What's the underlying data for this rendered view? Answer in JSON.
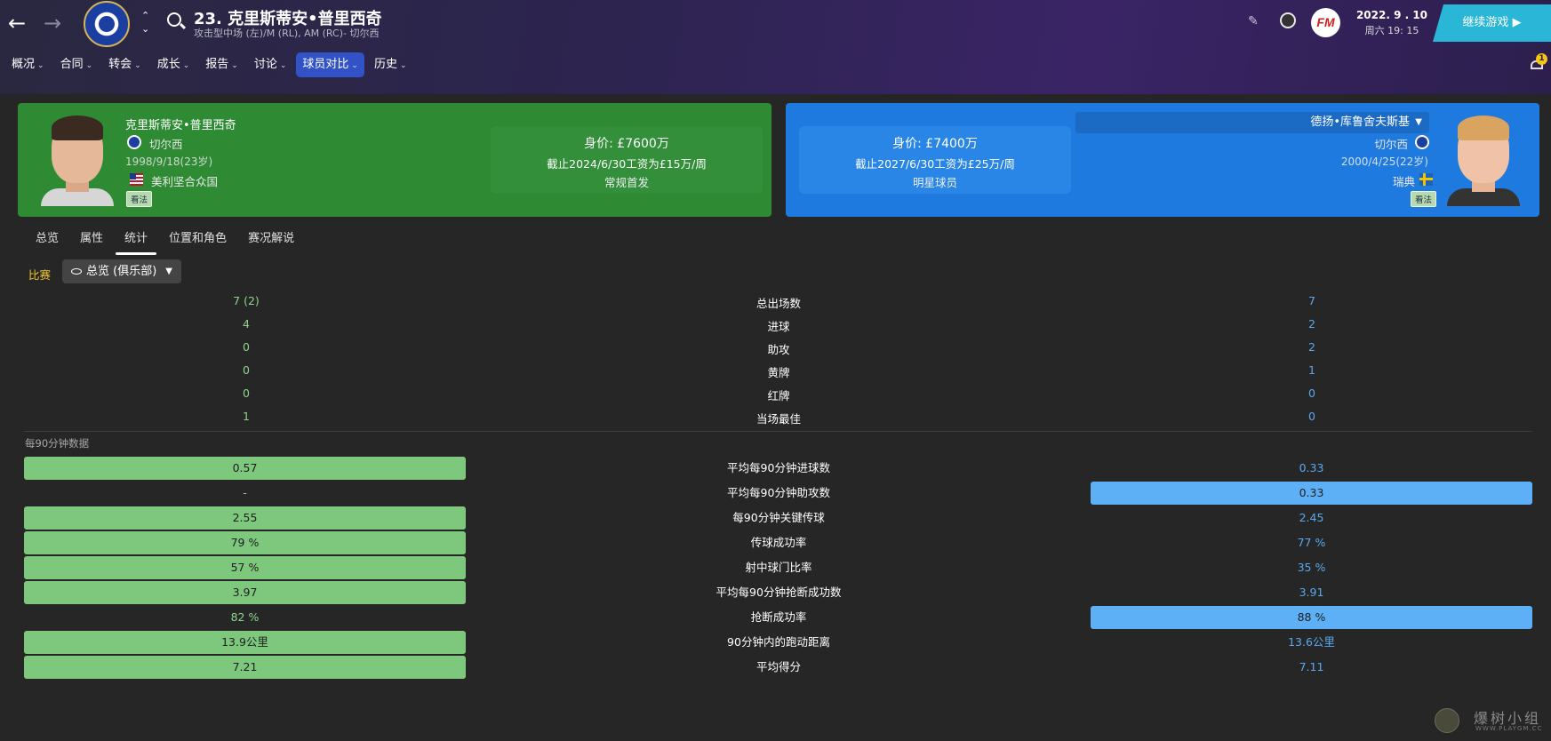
{
  "header": {
    "player_title": "23. 克里斯蒂安•普里西奇",
    "player_subtitle": "攻击型中场 (左)/M (RL), AM (RC)- 切尔西",
    "date_main": "2022. 9 . 10",
    "date_sub": "周六 19: 15",
    "continue_label": "继续游戏",
    "notification_count": "1",
    "fm_logo": "FM"
  },
  "menu": [
    {
      "label": "概况"
    },
    {
      "label": "合同"
    },
    {
      "label": "转会"
    },
    {
      "label": "成长"
    },
    {
      "label": "报告"
    },
    {
      "label": "讨论"
    },
    {
      "label": "球员对比",
      "active": true
    },
    {
      "label": "历史"
    }
  ],
  "left_player": {
    "name": "克里斯蒂安•普里西奇",
    "club": "切尔西",
    "dob": "1998/9/18(23岁)",
    "nationality": "美利坚合众国",
    "scout_tag": "看法",
    "value": "身价: £7600万",
    "wage": "截止2024/6/30工资为£15万/周",
    "role": "常规首发",
    "card_color": "#2e8b34"
  },
  "right_player": {
    "select_label": "德扬•库鲁舍夫斯基",
    "club": "切尔西",
    "dob": "2000/4/25(22岁)",
    "nationality": "瑞典",
    "scout_tag": "看法",
    "value": "身价: £7400万",
    "wage": "截止2027/6/30工资为£25万/周",
    "role": "明星球员",
    "card_color": "#1f7ae0"
  },
  "subtabs": [
    {
      "label": "总览"
    },
    {
      "label": "属性"
    },
    {
      "label": "统计",
      "active": true
    },
    {
      "label": "位置和角色"
    },
    {
      "label": "赛况解说"
    }
  ],
  "filter": {
    "label": "比赛",
    "dropdown": "总览 (俱乐部)"
  },
  "stats": [
    {
      "label": "总出场数",
      "left": "7 (2)",
      "right": "7"
    },
    {
      "label": "进球",
      "left": "4",
      "right": "2"
    },
    {
      "label": "助攻",
      "left": "0",
      "right": "2"
    },
    {
      "label": "黄牌",
      "left": "0",
      "right": "1"
    },
    {
      "label": "红牌",
      "left": "0",
      "right": "0"
    },
    {
      "label": "当场最佳",
      "left": "1",
      "right": "0"
    }
  ],
  "per90_label": "每90分钟数据",
  "per90": [
    {
      "label": "平均每90分钟进球数",
      "left": "0.57",
      "right": "0.33",
      "winner": "left"
    },
    {
      "label": "平均每90分钟助攻数",
      "left": "-",
      "right": "0.33",
      "winner": "right"
    },
    {
      "label": "每90分钟关键传球",
      "left": "2.55",
      "right": "2.45",
      "winner": "left"
    },
    {
      "label": "传球成功率",
      "left": "79 %",
      "right": "77 %",
      "winner": "left"
    },
    {
      "label": "射中球门比率",
      "left": "57 %",
      "right": "35 %",
      "winner": "left"
    },
    {
      "label": "平均每90分钟抢断成功数",
      "left": "3.97",
      "right": "3.91",
      "winner": "left"
    },
    {
      "label": "抢断成功率",
      "left": "82 %",
      "right": "88 %",
      "winner": "right"
    },
    {
      "label": "90分钟内的跑动距离",
      "left": "13.9公里",
      "right": "13.6公里",
      "winner": "left"
    },
    {
      "label": "平均得分",
      "left": "7.21",
      "right": "7.11",
      "winner": "left"
    }
  ],
  "watermark": {
    "cn": "爆树小组",
    "en": "WWW.PLAYGM.CC"
  },
  "icons": [
    "back-arrow-icon",
    "forward-arrow-icon",
    "club-crest-icon",
    "search-icon",
    "pencil-icon",
    "trophy-icon",
    "bell-icon",
    "eye-icon",
    "chevron-down-icon",
    "flag-usa-icon",
    "flag-sweden-icon"
  ]
}
